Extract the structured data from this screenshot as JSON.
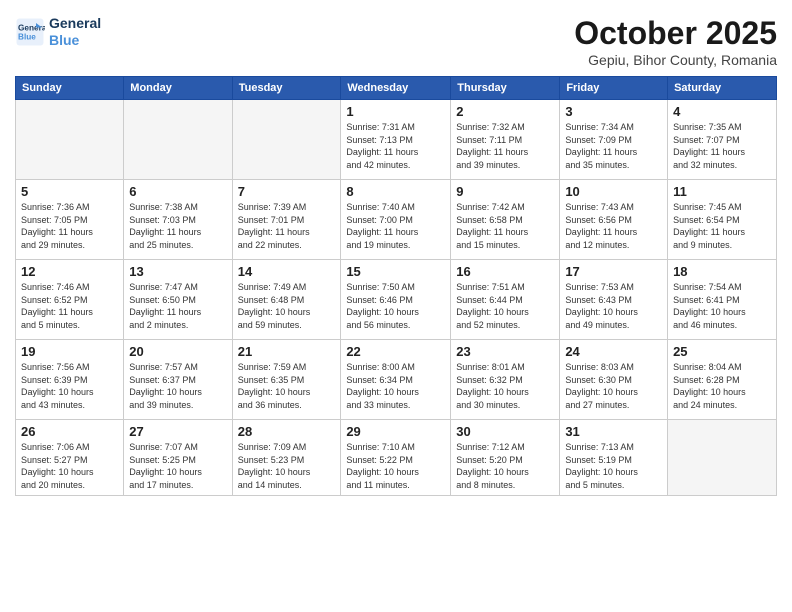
{
  "header": {
    "logo_line1": "General",
    "logo_line2": "Blue",
    "month": "October 2025",
    "location": "Gepiu, Bihor County, Romania"
  },
  "weekdays": [
    "Sunday",
    "Monday",
    "Tuesday",
    "Wednesday",
    "Thursday",
    "Friday",
    "Saturday"
  ],
  "weeks": [
    [
      {
        "day": "",
        "info": ""
      },
      {
        "day": "",
        "info": ""
      },
      {
        "day": "",
        "info": ""
      },
      {
        "day": "1",
        "info": "Sunrise: 7:31 AM\nSunset: 7:13 PM\nDaylight: 11 hours\nand 42 minutes."
      },
      {
        "day": "2",
        "info": "Sunrise: 7:32 AM\nSunset: 7:11 PM\nDaylight: 11 hours\nand 39 minutes."
      },
      {
        "day": "3",
        "info": "Sunrise: 7:34 AM\nSunset: 7:09 PM\nDaylight: 11 hours\nand 35 minutes."
      },
      {
        "day": "4",
        "info": "Sunrise: 7:35 AM\nSunset: 7:07 PM\nDaylight: 11 hours\nand 32 minutes."
      }
    ],
    [
      {
        "day": "5",
        "info": "Sunrise: 7:36 AM\nSunset: 7:05 PM\nDaylight: 11 hours\nand 29 minutes."
      },
      {
        "day": "6",
        "info": "Sunrise: 7:38 AM\nSunset: 7:03 PM\nDaylight: 11 hours\nand 25 minutes."
      },
      {
        "day": "7",
        "info": "Sunrise: 7:39 AM\nSunset: 7:01 PM\nDaylight: 11 hours\nand 22 minutes."
      },
      {
        "day": "8",
        "info": "Sunrise: 7:40 AM\nSunset: 7:00 PM\nDaylight: 11 hours\nand 19 minutes."
      },
      {
        "day": "9",
        "info": "Sunrise: 7:42 AM\nSunset: 6:58 PM\nDaylight: 11 hours\nand 15 minutes."
      },
      {
        "day": "10",
        "info": "Sunrise: 7:43 AM\nSunset: 6:56 PM\nDaylight: 11 hours\nand 12 minutes."
      },
      {
        "day": "11",
        "info": "Sunrise: 7:45 AM\nSunset: 6:54 PM\nDaylight: 11 hours\nand 9 minutes."
      }
    ],
    [
      {
        "day": "12",
        "info": "Sunrise: 7:46 AM\nSunset: 6:52 PM\nDaylight: 11 hours\nand 5 minutes."
      },
      {
        "day": "13",
        "info": "Sunrise: 7:47 AM\nSunset: 6:50 PM\nDaylight: 11 hours\nand 2 minutes."
      },
      {
        "day": "14",
        "info": "Sunrise: 7:49 AM\nSunset: 6:48 PM\nDaylight: 10 hours\nand 59 minutes."
      },
      {
        "day": "15",
        "info": "Sunrise: 7:50 AM\nSunset: 6:46 PM\nDaylight: 10 hours\nand 56 minutes."
      },
      {
        "day": "16",
        "info": "Sunrise: 7:51 AM\nSunset: 6:44 PM\nDaylight: 10 hours\nand 52 minutes."
      },
      {
        "day": "17",
        "info": "Sunrise: 7:53 AM\nSunset: 6:43 PM\nDaylight: 10 hours\nand 49 minutes."
      },
      {
        "day": "18",
        "info": "Sunrise: 7:54 AM\nSunset: 6:41 PM\nDaylight: 10 hours\nand 46 minutes."
      }
    ],
    [
      {
        "day": "19",
        "info": "Sunrise: 7:56 AM\nSunset: 6:39 PM\nDaylight: 10 hours\nand 43 minutes."
      },
      {
        "day": "20",
        "info": "Sunrise: 7:57 AM\nSunset: 6:37 PM\nDaylight: 10 hours\nand 39 minutes."
      },
      {
        "day": "21",
        "info": "Sunrise: 7:59 AM\nSunset: 6:35 PM\nDaylight: 10 hours\nand 36 minutes."
      },
      {
        "day": "22",
        "info": "Sunrise: 8:00 AM\nSunset: 6:34 PM\nDaylight: 10 hours\nand 33 minutes."
      },
      {
        "day": "23",
        "info": "Sunrise: 8:01 AM\nSunset: 6:32 PM\nDaylight: 10 hours\nand 30 minutes."
      },
      {
        "day": "24",
        "info": "Sunrise: 8:03 AM\nSunset: 6:30 PM\nDaylight: 10 hours\nand 27 minutes."
      },
      {
        "day": "25",
        "info": "Sunrise: 8:04 AM\nSunset: 6:28 PM\nDaylight: 10 hours\nand 24 minutes."
      }
    ],
    [
      {
        "day": "26",
        "info": "Sunrise: 7:06 AM\nSunset: 5:27 PM\nDaylight: 10 hours\nand 20 minutes."
      },
      {
        "day": "27",
        "info": "Sunrise: 7:07 AM\nSunset: 5:25 PM\nDaylight: 10 hours\nand 17 minutes."
      },
      {
        "day": "28",
        "info": "Sunrise: 7:09 AM\nSunset: 5:23 PM\nDaylight: 10 hours\nand 14 minutes."
      },
      {
        "day": "29",
        "info": "Sunrise: 7:10 AM\nSunset: 5:22 PM\nDaylight: 10 hours\nand 11 minutes."
      },
      {
        "day": "30",
        "info": "Sunrise: 7:12 AM\nSunset: 5:20 PM\nDaylight: 10 hours\nand 8 minutes."
      },
      {
        "day": "31",
        "info": "Sunrise: 7:13 AM\nSunset: 5:19 PM\nDaylight: 10 hours\nand 5 minutes."
      },
      {
        "day": "",
        "info": ""
      }
    ]
  ]
}
